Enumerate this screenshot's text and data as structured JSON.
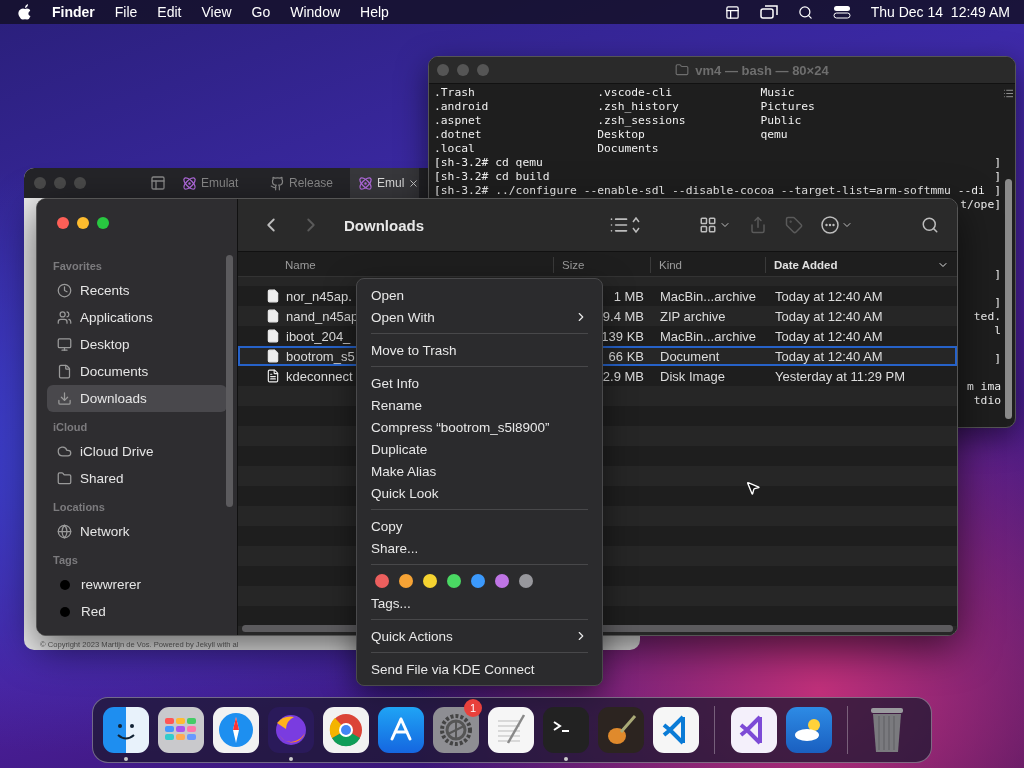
{
  "menu_bar": {
    "app": "Finder",
    "menus": [
      "File",
      "Edit",
      "View",
      "Go",
      "Window",
      "Help"
    ],
    "clock": "Thu Dec 14  12:49 AM"
  },
  "terminal": {
    "title": "vm4 — bash — 80×24",
    "lines": [
      {
        "kind": "text",
        "text": ".Trash                  .vscode-cli             Music"
      },
      {
        "kind": "text",
        "text": ".android                .zsh_history            Pictures"
      },
      {
        "kind": "text",
        "text": ".aspnet                 .zsh_sessions           Public"
      },
      {
        "kind": "text",
        "text": ".dotnet                 Desktop                 qemu"
      },
      {
        "kind": "text",
        "text": ".local                  Documents"
      },
      {
        "kind": "text",
        "text": "[sh-3.2# cd qemu",
        "end": "]"
      },
      {
        "kind": "text",
        "text": "[sh-3.2# cd build",
        "end": "]"
      },
      {
        "kind": "text",
        "text": "[sh-3.2# ../configure --enable-sdl --disable-cocoa --target-list=arm-softmmu --di",
        "end": "]"
      },
      {
        "kind": "text",
        "end": "t/ope]"
      },
      {
        "kind": "blank"
      },
      {
        "kind": "blank"
      },
      {
        "kind": "blank"
      },
      {
        "kind": "blank"
      },
      {
        "kind": "text",
        "end": "]"
      },
      {
        "kind": "blank"
      },
      {
        "kind": "text",
        "end": "]"
      },
      {
        "kind": "text",
        "end": "ted."
      },
      {
        "kind": "text",
        "end": "l"
      },
      {
        "kind": "blank"
      },
      {
        "kind": "text",
        "end": "]"
      },
      {
        "kind": "blank"
      },
      {
        "kind": "text",
        "end": "m ima"
      },
      {
        "kind": "text",
        "end": "tdio"
      }
    ]
  },
  "browser": {
    "tabs": [
      {
        "label": "Emulat",
        "selected": false
      },
      {
        "label": "Release",
        "selected": false
      },
      {
        "label": "Emul",
        "selected": true
      }
    ],
    "footer": "© Copyright 2023 Martijn de Vos. Powered by Jekyll with al"
  },
  "finder": {
    "title": "Downloads",
    "nav": [
      {
        "kind": "back",
        "disabled": false
      },
      {
        "kind": "forward",
        "disabled": true
      }
    ],
    "toolbar": [
      {
        "kind": "list-view",
        "disabled": false
      },
      {
        "kind": "group",
        "disabled": false
      },
      {
        "kind": "share",
        "disabled": true
      },
      {
        "kind": "tag",
        "disabled": true
      },
      {
        "kind": "more",
        "disabled": false
      },
      {
        "kind": "search",
        "disabled": false
      }
    ],
    "sidebar": [
      {
        "heading": "Favorites",
        "items": [
          {
            "label": "Recents",
            "selected": false
          },
          {
            "label": "Applications",
            "selected": false
          },
          {
            "label": "Desktop",
            "selected": false
          },
          {
            "label": "Documents",
            "selected": false
          },
          {
            "label": "Downloads",
            "selected": true
          }
        ]
      },
      {
        "heading": "iCloud",
        "items": [
          {
            "label": "iCloud Drive",
            "selected": false
          },
          {
            "label": "Shared",
            "selected": false
          }
        ]
      },
      {
        "heading": "Locations",
        "items": [
          {
            "label": "Network",
            "selected": false
          }
        ]
      },
      {
        "heading": "Tags",
        "items": [
          {
            "label": "rewwrerer",
            "selected": false,
            "color": "#000000"
          },
          {
            "label": "Red",
            "selected": false,
            "color": "#000000"
          }
        ]
      }
    ],
    "columns": [
      {
        "label": "Name",
        "sorted": false
      },
      {
        "label": "Size",
        "sorted": false
      },
      {
        "label": "Kind",
        "sorted": false
      },
      {
        "label": "Date Added",
        "sorted": true
      }
    ],
    "rows": [
      {
        "name": "nor_n45ap.",
        "size": "1 MB",
        "kind": "MacBin...archive",
        "date": "Today at 12:40 AM",
        "selected": false
      },
      {
        "name": "nand_n45ap",
        "size": "9.4 MB",
        "kind": "ZIP archive",
        "date": "Today at 12:40 AM",
        "selected": false
      },
      {
        "name": "iboot_204_",
        "size": "139 KB",
        "kind": "MacBin...archive",
        "date": "Today at 12:40 AM",
        "selected": false
      },
      {
        "name": "bootrom_s5",
        "size": "66 KB",
        "kind": "Document",
        "date": "Today at 12:40 AM",
        "selected": true
      },
      {
        "name": "kdeconnect",
        "size": "2.9 MB",
        "kind": "Disk Image",
        "date": "Yesterday at 11:29 PM",
        "selected": false
      }
    ]
  },
  "context_menu": [
    {
      "kind": "item",
      "label": "Open",
      "submenu": false
    },
    {
      "kind": "item",
      "label": "Open With",
      "submenu": true
    },
    {
      "kind": "separator"
    },
    {
      "kind": "item",
      "label": "Move to Trash",
      "submenu": false
    },
    {
      "kind": "separator"
    },
    {
      "kind": "item",
      "label": "Get Info",
      "submenu": false
    },
    {
      "kind": "item",
      "label": "Rename",
      "submenu": false
    },
    {
      "kind": "item",
      "label": "Compress “bootrom_s5l8900”",
      "submenu": false
    },
    {
      "kind": "item",
      "label": "Duplicate",
      "submenu": false
    },
    {
      "kind": "item",
      "label": "Make Alias",
      "submenu": false
    },
    {
      "kind": "item",
      "label": "Quick Look",
      "submenu": false
    },
    {
      "kind": "separator"
    },
    {
      "kind": "item",
      "label": "Copy",
      "submenu": false
    },
    {
      "kind": "item",
      "label": "Share...",
      "submenu": false
    },
    {
      "kind": "separator"
    },
    {
      "kind": "tags",
      "colors": [
        {
          "color": "#ec5f5e"
        },
        {
          "color": "#f6a335"
        },
        {
          "color": "#f5d330"
        },
        {
          "color": "#4ad863"
        },
        {
          "color": "#3b99fc"
        },
        {
          "color": "#bf75e5"
        },
        {
          "color": "#98989d"
        }
      ]
    },
    {
      "kind": "item",
      "label": "Tags...",
      "submenu": false
    },
    {
      "kind": "separator"
    },
    {
      "kind": "item",
      "label": "Quick Actions",
      "submenu": true
    },
    {
      "kind": "separator"
    },
    {
      "kind": "item",
      "label": "Send File via KDE Connect",
      "submenu": false
    }
  ],
  "dock": [
    {
      "kind": "app",
      "running": true
    },
    {
      "kind": "app",
      "running": false
    },
    {
      "kind": "app",
      "running": false
    },
    {
      "kind": "app",
      "running": true
    },
    {
      "kind": "app",
      "running": false
    },
    {
      "kind": "app",
      "running": false
    },
    {
      "kind": "app",
      "running": false,
      "badge": "1"
    },
    {
      "kind": "app",
      "running": false
    },
    {
      "kind": "app",
      "running": true
    },
    {
      "kind": "app",
      "running": false
    },
    {
      "kind": "app",
      "running": false
    },
    {
      "kind": "separator"
    },
    {
      "kind": "app",
      "running": false
    },
    {
      "kind": "app",
      "running": false
    },
    {
      "kind": "separator"
    },
    {
      "kind": "trash",
      "running": false
    }
  ]
}
